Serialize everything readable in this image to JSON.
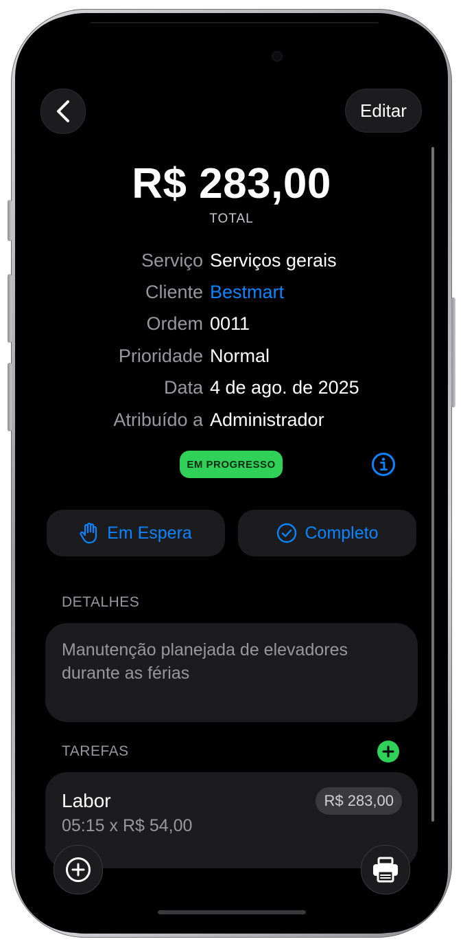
{
  "header": {
    "back_icon": "chevron-left-icon",
    "edit_label": "Editar"
  },
  "summary": {
    "amount": "R$ 283,00",
    "amount_label": "TOTAL"
  },
  "info": {
    "service_label": "Serviço",
    "service_value": "Serviços gerais",
    "client_label": "Cliente",
    "client_value": "Bestmart",
    "order_label": "Ordem",
    "order_value": "0011",
    "priority_label": "Prioridade",
    "priority_value": "Normal",
    "date_label": "Data",
    "date_value": "4 de ago. de 2025",
    "assigned_label": "Atribuído a",
    "assigned_value": "Administrador"
  },
  "status": {
    "badge": "EM PROGRESSO",
    "badge_color": "#30d158",
    "info_icon": "info-circle-icon"
  },
  "actions": {
    "hold_label": "Em Espera",
    "hold_icon": "hand-raised-icon",
    "complete_label": "Completo",
    "complete_icon": "checkmark-circle-icon",
    "accent_color": "#0a84ff"
  },
  "details": {
    "section_title": "DETALHES",
    "text": "Manutenção planejada de elevadores durante as férias"
  },
  "tasks": {
    "section_title": "TAREFAS",
    "add_icon": "plus-circle-fill-icon",
    "items": [
      {
        "title": "Labor",
        "subtitle": "05:15 x R$ 54,00",
        "price": "R$ 283,00"
      }
    ]
  },
  "footer": {
    "add_icon": "plus-circle-icon",
    "print_icon": "printer-icon"
  }
}
